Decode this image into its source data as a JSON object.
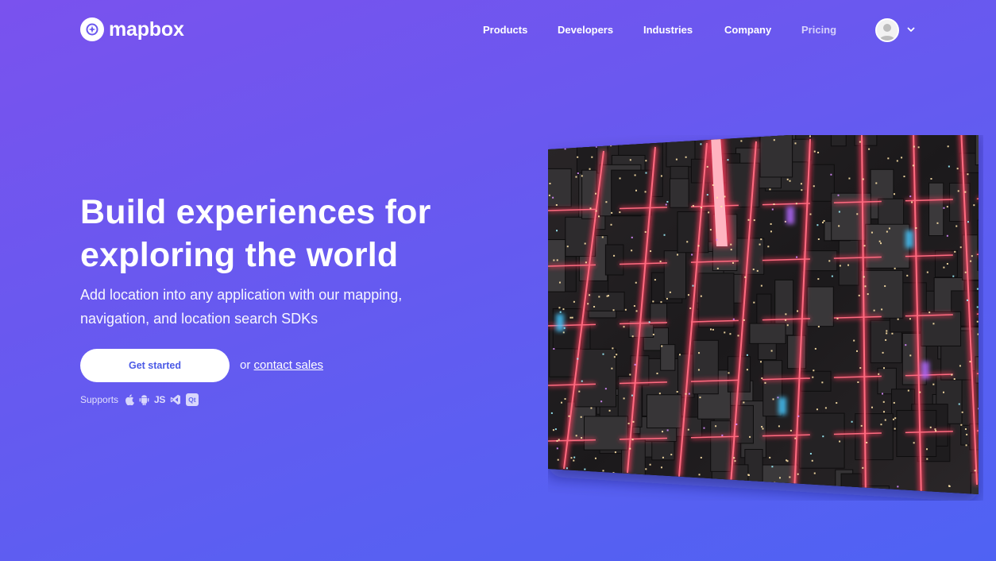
{
  "header": {
    "brand": "mapbox",
    "nav": [
      {
        "label": "Products"
      },
      {
        "label": "Developers"
      },
      {
        "label": "Industries"
      },
      {
        "label": "Company"
      },
      {
        "label": "Pricing"
      }
    ]
  },
  "hero": {
    "headline_line1": "Build experiences for",
    "headline_line2": "exploring the world",
    "subhead_line1": "Add location into any application with our mapping,",
    "subhead_line2": "navigation, and location search SDKs",
    "cta_primary": "Get started",
    "cta_alt_prefix": "or",
    "cta_alt_link": "contact sales",
    "supports_label": "Supports",
    "supports_icons": [
      "apple-icon",
      "android-icon",
      "js-icon",
      "visual-studio-icon",
      "qt-icon"
    ],
    "supports_js": "JS",
    "supports_qt": "Qt"
  },
  "colors": {
    "bg_start": "#7a52ee",
    "bg_end": "#4f62f3",
    "cta_text": "#4b5ae6",
    "neon_red": "#ff3b5c"
  }
}
